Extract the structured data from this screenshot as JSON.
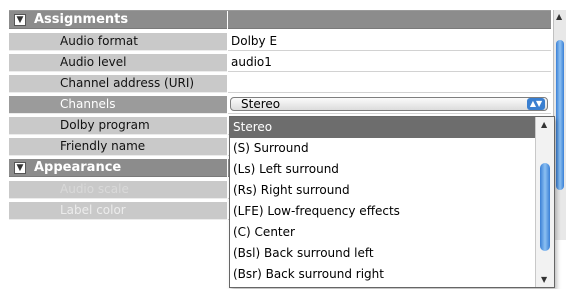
{
  "property_grid": {
    "sections": {
      "assignments": {
        "title": "Assignments",
        "checkbox_glyph": "▼"
      },
      "appearance": {
        "title": "Appearance",
        "checkbox_glyph": "▼"
      }
    },
    "rows": [
      {
        "label": "Audio format",
        "value": "Dolby E"
      },
      {
        "label": "Audio level",
        "value": "audio1"
      },
      {
        "label": "Channel address (URI)",
        "value": ""
      },
      {
        "label": "Channels",
        "value": "Stereo"
      },
      {
        "label": "Dolby program",
        "value": ""
      },
      {
        "label": "Friendly name",
        "value": ""
      }
    ],
    "appearance_rows": [
      {
        "label": "Audio scale"
      },
      {
        "label": "Label color"
      }
    ]
  },
  "channels_dropdown": {
    "selected": "Stereo",
    "options": [
      "Stereo",
      "(S) Surround",
      "(Ls) Left surround",
      "(Rs) Right surround",
      "(LFE) Low-frequency effects",
      "(C) Center",
      "(Bsl) Back surround left",
      "(Bsr) Back surround right"
    ]
  },
  "icons": {
    "scroll_up": "▲",
    "scroll_down": "▼",
    "select_arrows": "▲▼"
  },
  "colors": {
    "section_header": "#8c8c8c",
    "label_bg": "#c9c9c9",
    "highlight": "#6d6d6d",
    "scroll_accent": "#3a80d6"
  }
}
